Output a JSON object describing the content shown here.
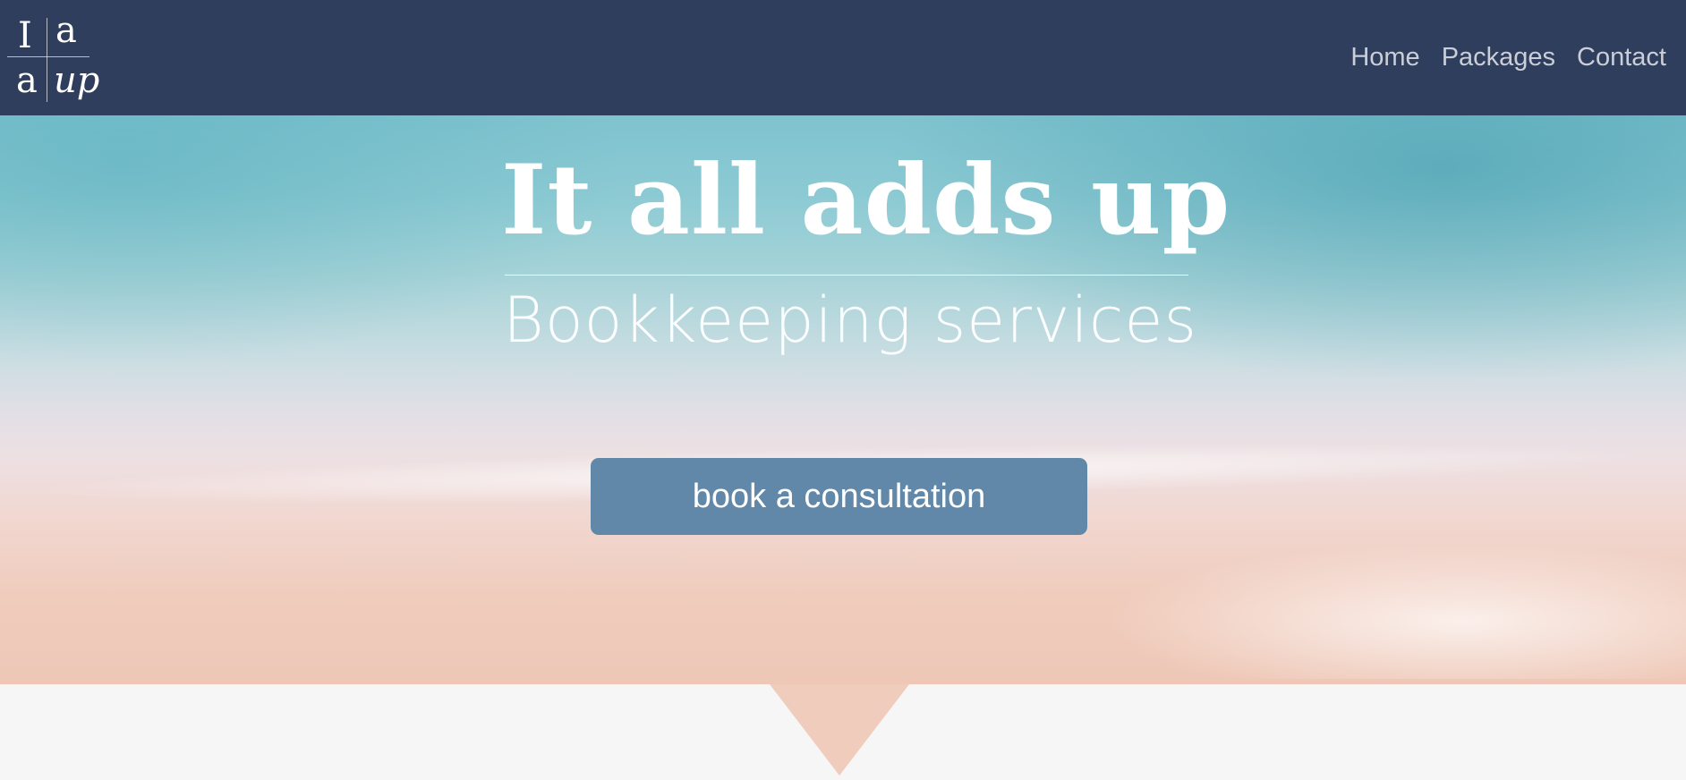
{
  "logo": {
    "letters": [
      "I",
      "a",
      "a",
      "up"
    ]
  },
  "nav": {
    "items": [
      {
        "label": "Home"
      },
      {
        "label": "Packages"
      },
      {
        "label": "Contact"
      }
    ]
  },
  "hero": {
    "title": "It all adds up",
    "subtitle": "Bookkeeping services",
    "cta_label": "book a consultation"
  },
  "colors": {
    "header_bg": "#2f3e5c",
    "nav_text": "#c9ced8",
    "cta_bg": "#6188a9",
    "page_bg": "#f6f6f6",
    "sand": "#f0ccbd"
  }
}
